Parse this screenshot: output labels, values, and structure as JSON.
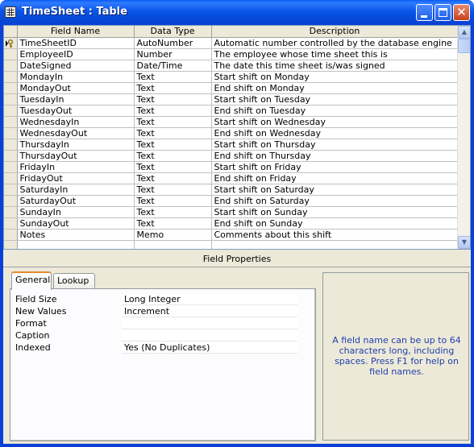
{
  "window": {
    "title": "TimeSheet : Table"
  },
  "grid": {
    "headers": {
      "field_name": "Field Name",
      "data_type": "Data Type",
      "description": "Description"
    },
    "rows": [
      {
        "name": "TimeSheetID",
        "type": "AutoNumber",
        "desc": "Automatic number controlled by the database engine",
        "primary_key": true
      },
      {
        "name": "EmployeeID",
        "type": "Number",
        "desc": "The employee whose time sheet this is"
      },
      {
        "name": "DateSigned",
        "type": "Date/Time",
        "desc": "The date this time sheet is/was signed"
      },
      {
        "name": "MondayIn",
        "type": "Text",
        "desc": "Start shift on Monday"
      },
      {
        "name": "MondayOut",
        "type": "Text",
        "desc": "End shift on Monday"
      },
      {
        "name": "TuesdayIn",
        "type": "Text",
        "desc": "Start shift on Tuesday"
      },
      {
        "name": "TuesdayOut",
        "type": "Text",
        "desc": "End shift on Tuesday"
      },
      {
        "name": "WednesdayIn",
        "type": "Text",
        "desc": "Start shift on Wednesday"
      },
      {
        "name": "WednesdayOut",
        "type": "Text",
        "desc": "End shift on Wednesday"
      },
      {
        "name": "ThursdayIn",
        "type": "Text",
        "desc": "Start shift on Thursday"
      },
      {
        "name": "ThursdayOut",
        "type": "Text",
        "desc": "End shift on Thursday"
      },
      {
        "name": "FridayIn",
        "type": "Text",
        "desc": "Start shift on Friday"
      },
      {
        "name": "FridayOut",
        "type": "Text",
        "desc": "End shift on Friday"
      },
      {
        "name": "SaturdayIn",
        "type": "Text",
        "desc": "Start shift on Saturday"
      },
      {
        "name": "SaturdayOut",
        "type": "Text",
        "desc": "End shift on Saturday"
      },
      {
        "name": "SundayIn",
        "type": "Text",
        "desc": "Start shift on Sunday"
      },
      {
        "name": "SundayOut",
        "type": "Text",
        "desc": "End shift on Sunday"
      },
      {
        "name": "Notes",
        "type": "Memo",
        "desc": "Comments about this shift"
      },
      {
        "name": "",
        "type": "",
        "desc": ""
      }
    ]
  },
  "field_properties": {
    "label": "Field Properties",
    "tabs": [
      "General",
      "Lookup"
    ],
    "properties": [
      {
        "label": "Field Size",
        "value": "Long Integer"
      },
      {
        "label": "New Values",
        "value": "Increment"
      },
      {
        "label": "Format",
        "value": ""
      },
      {
        "label": "Caption",
        "value": ""
      },
      {
        "label": "Indexed",
        "value": "Yes (No Duplicates)"
      }
    ],
    "help_text": "A field name can be up to 64 characters long, including spaces.  Press F1 for help on field names."
  }
}
